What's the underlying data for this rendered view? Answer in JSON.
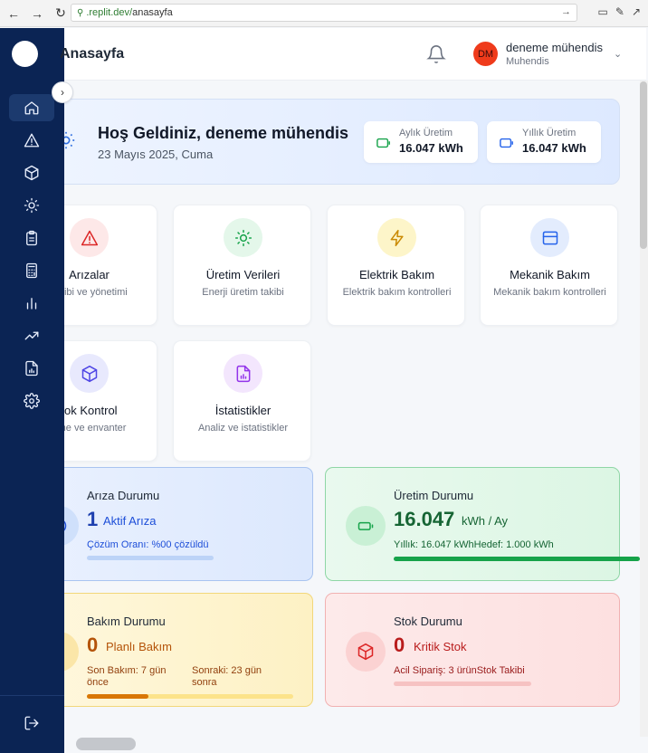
{
  "browser": {
    "url_host": ".replit.dev/",
    "url_path": "anasayfa"
  },
  "header": {
    "title": "Anasayfa",
    "user_initials": "DM",
    "user_name": "deneme mühendis",
    "user_role": "Muhendis"
  },
  "sidebar": {
    "items": [
      "home-icon",
      "alert-triangle-icon",
      "box-icon",
      "sun-icon",
      "clipboard-icon",
      "calculator-icon",
      "bar-chart-icon",
      "trending-up-icon",
      "file-chart-icon",
      "gear-icon"
    ],
    "active": "home-icon",
    "bottom": "logout-icon"
  },
  "welcome": {
    "title": "Hoş Geldiniz, deneme mühendis",
    "date": "23 Mayıs 2025, Cuma",
    "monthly_label": "Aylık Üretim",
    "monthly_value": "16.047 kWh",
    "yearly_label": "Yıllık Üretim",
    "yearly_value": "16.047 kWh"
  },
  "quick_cards": [
    {
      "title": "Arızalar",
      "desc": "takibi ve yönetimi",
      "icon": "alert-triangle-icon",
      "color": "#dc2626",
      "bg": "#fde8e8"
    },
    {
      "title": "Üretim Verileri",
      "desc": "Enerji üretim takibi",
      "icon": "sun-icon",
      "color": "#16a34a",
      "bg": "#e4f7ea"
    },
    {
      "title": "Elektrik Bakım",
      "desc": "Elektrik bakım kontrolleri",
      "icon": "zap-icon",
      "color": "#ca8a04",
      "bg": "#fdf5c9"
    },
    {
      "title": "Mekanik Bakım",
      "desc": "Mekanik bakım kontrolleri",
      "icon": "panel-icon",
      "color": "#2563eb",
      "bg": "#e3ecfd"
    },
    {
      "title": "tok Kontrol",
      "desc": "eme ve envanter",
      "icon": "box-icon",
      "color": "#4f46e5",
      "bg": "#e8e9fd"
    },
    {
      "title": "İstatistikler",
      "desc": "Analiz ve istatistikler",
      "icon": "file-chart-icon",
      "color": "#9333ea",
      "bg": "#f3e6fd"
    }
  ],
  "status": {
    "fault": {
      "title": "Arıza Durumu",
      "count": "1",
      "count_label": "Aktif Arıza",
      "note": "Çözüm Oranı: %00 çözüldü",
      "progress": 0
    },
    "production": {
      "title": "Üretim Durumu",
      "value": "16.047",
      "unit": "kWh / Ay",
      "note": "Yıllık: 16.047 kWhHedef: 1.000 kWh",
      "progress": 1.0
    },
    "maintenance": {
      "title": "Bakım Durumu",
      "count": "0",
      "count_label": "Planlı Bakım",
      "last_label": "Son Bakım: 7 gün önce",
      "next_label": "Sonraki: 23 gün sonra",
      "progress": 0.23
    },
    "stock": {
      "title": "Stok Durumu",
      "count": "0",
      "count_label": "Kritik Stok",
      "note": "Acil Sipariş: 3 ürünStok Takibi",
      "progress": 0
    }
  }
}
